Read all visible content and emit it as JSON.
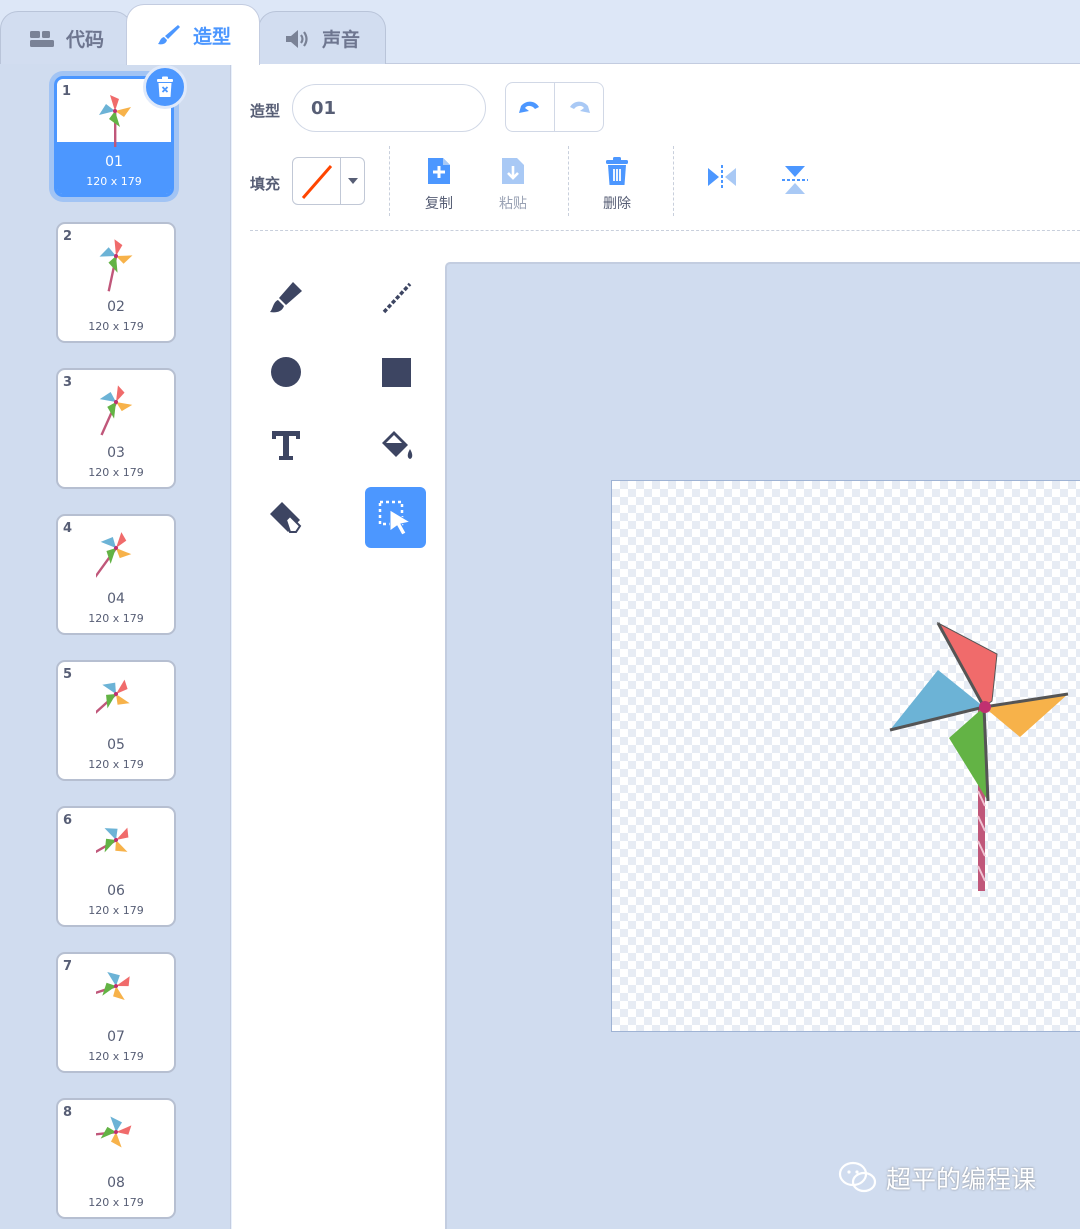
{
  "tabs": [
    {
      "label": "代码",
      "icon": "code-blocks-icon",
      "active": false
    },
    {
      "label": "造型",
      "icon": "paintbrush-icon",
      "active": true
    },
    {
      "label": "声音",
      "icon": "speaker-icon",
      "active": false
    }
  ],
  "costumes": [
    {
      "number": "1",
      "name": "01",
      "size": "120 x 179",
      "selected": true
    },
    {
      "number": "2",
      "name": "02",
      "size": "120 x 179"
    },
    {
      "number": "3",
      "name": "03",
      "size": "120 x 179"
    },
    {
      "number": "4",
      "name": "04",
      "size": "120 x 179"
    },
    {
      "number": "5",
      "name": "05",
      "size": "120 x 179"
    },
    {
      "number": "6",
      "name": "06",
      "size": "120 x 179"
    },
    {
      "number": "7",
      "name": "07",
      "size": "120 x 179"
    },
    {
      "number": "8",
      "name": "08",
      "size": "120 x 179"
    }
  ],
  "editor": {
    "costume_label": "造型",
    "costume_name": "01",
    "fill_label": "填充",
    "fill_color": "#ff4500",
    "buttons": {
      "copy": "复制",
      "paste": "粘贴",
      "delete": "删除"
    },
    "tools": [
      "brush-icon",
      "line-icon",
      "circle-icon",
      "rectangle-icon",
      "text-icon",
      "fill-bucket-icon",
      "eraser-icon",
      "select-icon"
    ],
    "active_tool": "select-icon"
  },
  "watermark": "超平的编程课",
  "colors": {
    "accent": "#4c97ff",
    "sidebar": "#d0dcef",
    "text": "#575e75"
  }
}
